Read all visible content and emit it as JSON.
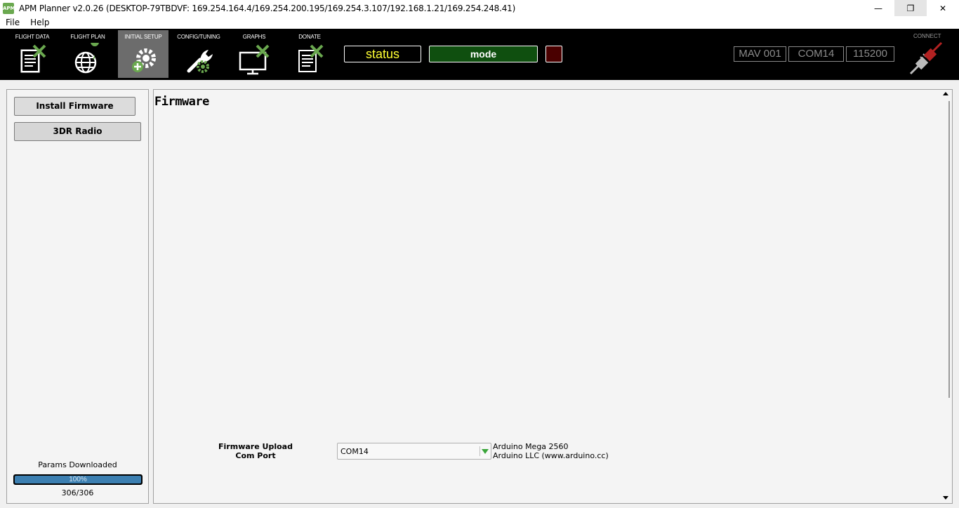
{
  "window": {
    "app_icon_text": "APM",
    "title": "APM Planner v2.0.26 (DESKTOP-79TBDVF: 169.254.164.4/169.254.200.195/169.254.3.107/192.168.1.21/169.254.248.41)",
    "minimize_glyph": "—",
    "maximize_glyph": "❐",
    "close_glyph": "✕"
  },
  "menu": {
    "items": [
      {
        "label": "File"
      },
      {
        "label": "Help"
      }
    ]
  },
  "toolbar": {
    "nav": [
      {
        "label": "FLIGHT DATA",
        "icon": "flight-data-icon",
        "active": false
      },
      {
        "label": "FLIGHT PLAN",
        "icon": "flight-plan-icon",
        "active": false
      },
      {
        "label": "INITIAL SETUP",
        "icon": "initial-setup-icon",
        "active": true
      },
      {
        "label": "CONFIG/TUNING",
        "icon": "config-tuning-icon",
        "active": false
      },
      {
        "label": "GRAPHS",
        "icon": "graphs-icon",
        "active": false
      },
      {
        "label": "DONATE",
        "icon": "donate-icon",
        "active": false
      }
    ],
    "status_text": "status",
    "mode_text": "mode",
    "mav_id": "MAV 001",
    "com_port": "COM14",
    "baud_rate": "115200",
    "connect_label": "CONNECT",
    "colors": {
      "accent_green": "#6aa84f",
      "status_yellow": "#ffff33",
      "mode_green": "#0f4f0f",
      "alert_red": "#4a0000"
    }
  },
  "sidebar": {
    "install_firmware_label": "Install Firmware",
    "radio_label": "3DR Radio",
    "params_label": "Params Downloaded",
    "progress_percent": 100,
    "progress_text": "100%",
    "params_count": "306/306"
  },
  "main": {
    "title": "Firmware",
    "upload_label_line1": "Firmware Upload",
    "upload_label_line2": "Com Port",
    "selected_port": "COM14",
    "device_name": "Arduino Mega 2560",
    "device_vendor": "Arduino LLC (www.arduino.cc)"
  }
}
